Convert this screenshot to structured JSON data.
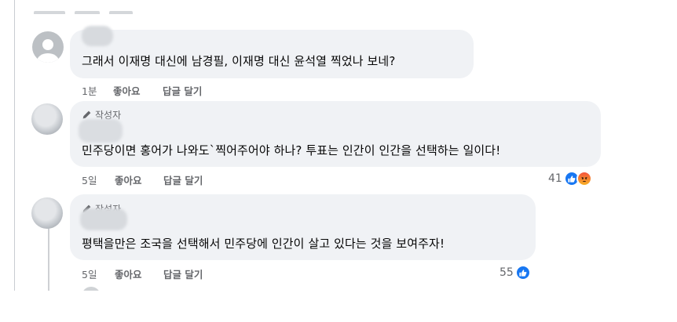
{
  "comments": [
    {
      "author_badge": "",
      "text": "그래서 이재명 대신에 남경필, 이재명 대신 윤석열 찍었나 보네?",
      "time": "1분",
      "like_label": "좋아요",
      "reply_label": "답글 달기",
      "reaction_count": ""
    },
    {
      "author_badge": "작성자",
      "text": "민주당이면 홍어가 나와도`찍어주어야 하나? 투표는 인간이 인간을 선택하는 일이다!",
      "time": "5일",
      "like_label": "좋아요",
      "reply_label": "답글 달기",
      "reaction_count": "41",
      "reactions": [
        "like-icon",
        "angry-icon"
      ]
    },
    {
      "author_badge": "작성자",
      "text": "평택을만은 조국을 선택해서 민주당에 인간이 살고 있다는 것을 보여주자!",
      "time": "5일",
      "like_label": "좋아요",
      "reply_label": "답글 달기",
      "reaction_count": "55",
      "reactions": [
        "like-icon"
      ]
    }
  ],
  "colors": {
    "bubble": "#f0f2f5",
    "meta_text": "#65676b",
    "like_blue": "#1877f2",
    "angry_top": "#f5533d",
    "angry_bottom": "#f7b125"
  }
}
